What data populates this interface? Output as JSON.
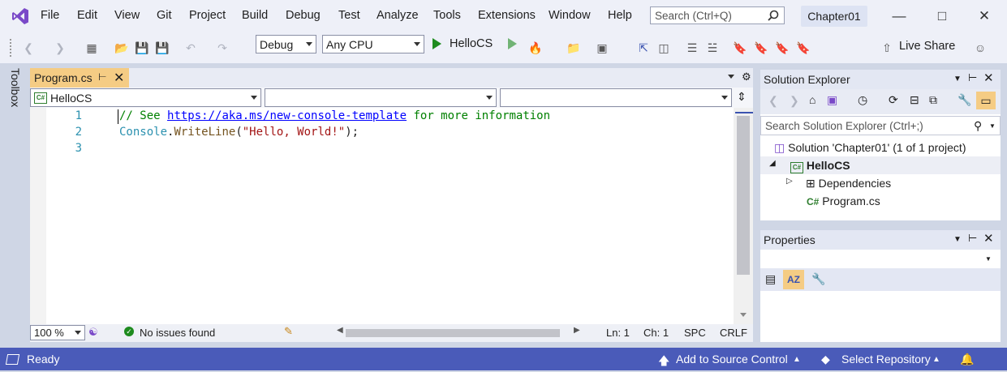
{
  "menu": {
    "items": [
      "File",
      "Edit",
      "View",
      "Git",
      "Project",
      "Build",
      "Debug",
      "Test",
      "Analyze",
      "Tools",
      "Extensions",
      "Window",
      "Help"
    ],
    "search_placeholder": "Search (Ctrl+Q)",
    "solution_name": "Chapter01"
  },
  "toolbar": {
    "configuration": "Debug",
    "platform": "Any CPU",
    "run_target": "HelloCS",
    "live_share": "Live Share"
  },
  "toolbox": {
    "label": "Toolbox"
  },
  "editor": {
    "tab_label": "Program.cs",
    "nav_project": "HelloCS",
    "lines": [
      {
        "num": "1",
        "comment": "// See ",
        "link": "https://aka.ms/new-console-template",
        "rest": " for more information"
      },
      {
        "num": "2",
        "type": "Console",
        "dot": ".",
        "method": "WriteLine",
        "open": "(",
        "string": "\"Hello, World!\"",
        "close": ");"
      },
      {
        "num": "3"
      }
    ],
    "zoom": "100 %",
    "issues": "No issues found",
    "ln": "Ln: 1",
    "ch": "Ch: 1",
    "spc": "SPC",
    "crlf": "CRLF"
  },
  "solution_explorer": {
    "title": "Solution Explorer",
    "search_placeholder": "Search Solution Explorer (Ctrl+;)",
    "solution_label": "Solution 'Chapter01' (1 of 1 project)",
    "project": "HelloCS",
    "dependencies": "Dependencies",
    "file": "Program.cs"
  },
  "properties": {
    "title": "Properties"
  },
  "statusbar": {
    "ready": "Ready",
    "source_control": "Add to Source Control",
    "repository": "Select Repository"
  },
  "colors": {
    "accent": "#4a5bb9",
    "tab_active": "#f5cc84",
    "comment": "#008000",
    "type": "#2b91af",
    "string": "#a31515"
  }
}
